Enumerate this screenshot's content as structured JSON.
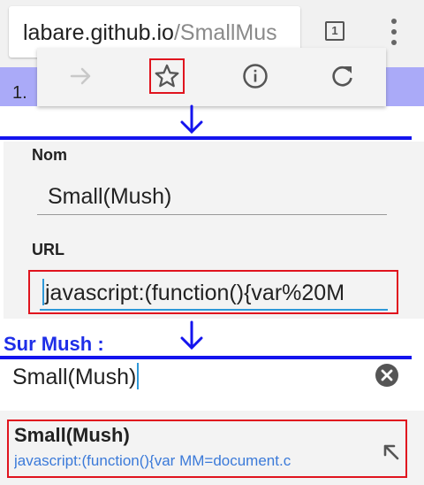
{
  "browser": {
    "url_host": "labare.github.io",
    "url_path": "/SmallMus",
    "tab_count": "1"
  },
  "page": {
    "visible_text": "1."
  },
  "menu": {
    "icons": [
      "forward-arrow-icon",
      "star-icon",
      "info-icon",
      "refresh-icon"
    ]
  },
  "bookmark_form": {
    "name_label": "Nom",
    "name_value": "Small(Mush)",
    "url_label": "URL",
    "url_value": "javascript:(function(){var%20M"
  },
  "annotation": {
    "sur_mush": "Sur Mush :",
    "highlight_color": "#e0141e",
    "annotation_color": "#1414ee"
  },
  "search": {
    "query": "Small(Mush)"
  },
  "suggestion": {
    "title": "Small(Mush)",
    "url": "javascript:(function(){var MM=document.c"
  }
}
